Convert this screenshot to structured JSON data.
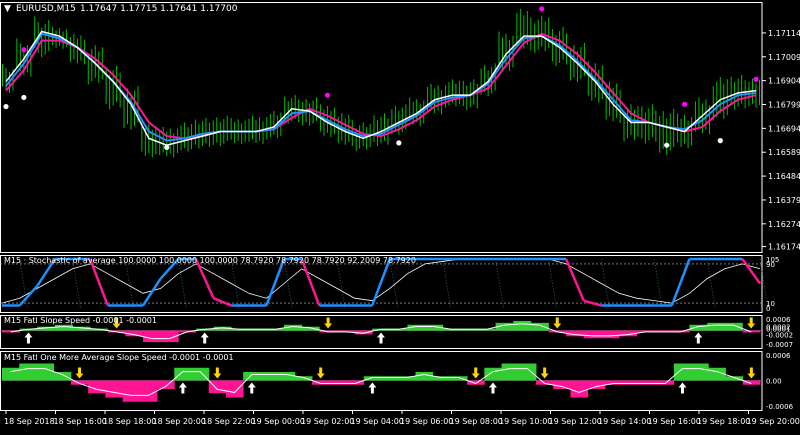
{
  "title": "EURUSD,M15",
  "ohlc": "1.17647 1.17715 1.17641 1.17700",
  "header_arrow": "▼",
  "colors": {
    "background": "#000000",
    "bull": "#00c000",
    "bear": "#ff1493",
    "fast_ma": "#ffffff",
    "slow_ma": "#1e90ff",
    "pink_ma": "#ff1493",
    "dot_pink": "#ff00ff",
    "dot_white": "#ffffff",
    "arrow_up": "#ffffff",
    "arrow_down": "#ffd700",
    "stoch_blue": "#1e90ff",
    "stoch_pink": "#ff1493",
    "hist_green": "#32cd32",
    "hist_pink": "#ff1493",
    "grid": "#c0c0c0",
    "axis": "#ffffff"
  },
  "x_axis": {
    "labels": [
      "18 Sep 2018",
      "18 Sep 16:00",
      "18 Sep 18:00",
      "18 Sep 20:00",
      "18 Sep 22:00",
      "19 Sep 00:00",
      "19 Sep 02:00",
      "19 Sep 04:00",
      "19 Sep 06:00",
      "19 Sep 08:00",
      "19 Sep 10:00",
      "19 Sep 12:00",
      "19 Sep 14:00",
      "19 Sep 16:00",
      "19 Sep 18:00",
      "19 Sep 20:00"
    ]
  },
  "chart_data": [
    {
      "type": "line",
      "panel": "price",
      "ylim": [
        1.1615,
        1.1725
      ],
      "yticks": [
        "1.17114",
        "1.17009",
        "1.16904",
        "1.16799",
        "1.16694",
        "1.16589",
        "1.16484",
        "1.16379",
        "1.16274",
        "1.16174"
      ],
      "series": [
        {
          "name": "fast",
          "values": [
            1.169,
            1.17,
            1.1712,
            1.171,
            1.1705,
            1.1698,
            1.169,
            1.168,
            1.1665,
            1.1662,
            1.1664,
            1.1666,
            1.1668,
            1.1668,
            1.1668,
            1.167,
            1.1678,
            1.1677,
            1.1672,
            1.1668,
            1.1665,
            1.1668,
            1.1672,
            1.1676,
            1.1682,
            1.1684,
            1.1684,
            1.169,
            1.1702,
            1.171,
            1.171,
            1.1705,
            1.1698,
            1.169,
            1.168,
            1.1672,
            1.1672,
            1.167,
            1.1668,
            1.1675,
            1.1682,
            1.1685,
            1.1686
          ]
        },
        {
          "name": "slow",
          "values": [
            1.1688,
            1.1698,
            1.1711,
            1.1709,
            1.1705,
            1.1698,
            1.169,
            1.1681,
            1.1668,
            1.1664,
            1.1665,
            1.1667,
            1.1668,
            1.1668,
            1.1668,
            1.1669,
            1.1676,
            1.1677,
            1.1673,
            1.1669,
            1.1666,
            1.1667,
            1.1671,
            1.1675,
            1.1681,
            1.1683,
            1.1684,
            1.1689,
            1.17,
            1.1709,
            1.171,
            1.1706,
            1.1699,
            1.1691,
            1.1682,
            1.1673,
            1.1672,
            1.167,
            1.1669,
            1.1673,
            1.168,
            1.1684,
            1.1685
          ]
        },
        {
          "name": "pink",
          "values": [
            1.1686,
            1.1695,
            1.1708,
            1.1708,
            1.1705,
            1.17,
            1.1693,
            1.1684,
            1.1672,
            1.1666,
            1.1665,
            1.1666,
            1.1668,
            1.1668,
            1.1668,
            1.1669,
            1.1674,
            1.1678,
            1.1675,
            1.1671,
            1.1667,
            1.1666,
            1.1669,
            1.1673,
            1.1679,
            1.1682,
            1.1684,
            1.1687,
            1.1697,
            1.1707,
            1.1711,
            1.1708,
            1.1702,
            1.1694,
            1.1685,
            1.1676,
            1.1672,
            1.167,
            1.1668,
            1.167,
            1.1677,
            1.1682,
            1.1684
          ]
        }
      ],
      "candles": [
        {
          "h": 1.1696,
          "l": 1.1684
        },
        {
          "h": 1.1706,
          "l": 1.1691
        },
        {
          "h": 1.1717,
          "l": 1.17
        },
        {
          "h": 1.1714,
          "l": 1.1704
        },
        {
          "h": 1.1711,
          "l": 1.1697
        },
        {
          "h": 1.1706,
          "l": 1.1688
        },
        {
          "h": 1.1697,
          "l": 1.1677
        },
        {
          "h": 1.1688,
          "l": 1.1668
        },
        {
          "h": 1.1672,
          "l": 1.1656
        },
        {
          "h": 1.167,
          "l": 1.1656
        },
        {
          "h": 1.1672,
          "l": 1.1658
        },
        {
          "h": 1.1674,
          "l": 1.166
        },
        {
          "h": 1.1675,
          "l": 1.1661
        },
        {
          "h": 1.1674,
          "l": 1.1662
        },
        {
          "h": 1.1675,
          "l": 1.1662
        },
        {
          "h": 1.1677,
          "l": 1.1664
        },
        {
          "h": 1.1684,
          "l": 1.1671
        },
        {
          "h": 1.1683,
          "l": 1.167
        },
        {
          "h": 1.168,
          "l": 1.1665
        },
        {
          "h": 1.1676,
          "l": 1.1661
        },
        {
          "h": 1.1672,
          "l": 1.1659
        },
        {
          "h": 1.1676,
          "l": 1.1661
        },
        {
          "h": 1.168,
          "l": 1.1666
        },
        {
          "h": 1.1683,
          "l": 1.167
        },
        {
          "h": 1.1689,
          "l": 1.1675
        },
        {
          "h": 1.1691,
          "l": 1.1678
        },
        {
          "h": 1.1691,
          "l": 1.1677
        },
        {
          "h": 1.1698,
          "l": 1.1683
        },
        {
          "h": 1.1712,
          "l": 1.1694
        },
        {
          "h": 1.1722,
          "l": 1.1703
        },
        {
          "h": 1.1719,
          "l": 1.1702
        },
        {
          "h": 1.1714,
          "l": 1.1696
        },
        {
          "h": 1.1707,
          "l": 1.1689
        },
        {
          "h": 1.1699,
          "l": 1.168
        },
        {
          "h": 1.169,
          "l": 1.1671
        },
        {
          "h": 1.168,
          "l": 1.1663
        },
        {
          "h": 1.168,
          "l": 1.1662
        },
        {
          "h": 1.1678,
          "l": 1.1657
        },
        {
          "h": 1.1676,
          "l": 1.166
        },
        {
          "h": 1.1683,
          "l": 1.1666
        },
        {
          "h": 1.1692,
          "l": 1.1672
        },
        {
          "h": 1.1693,
          "l": 1.1677
        },
        {
          "h": 1.1692,
          "l": 1.1678
        }
      ],
      "dots": [
        {
          "i": 1,
          "v": 1.1704,
          "c": "pink"
        },
        {
          "i": 0,
          "v": 1.1679,
          "c": "white"
        },
        {
          "i": 1,
          "v": 1.1683,
          "c": "white"
        },
        {
          "i": 9,
          "v": 1.1661,
          "c": "white"
        },
        {
          "i": 18,
          "v": 1.1684,
          "c": "pink"
        },
        {
          "i": 22,
          "v": 1.1663,
          "c": "white"
        },
        {
          "i": 30,
          "v": 1.1722,
          "c": "pink"
        },
        {
          "i": 38,
          "v": 1.168,
          "c": "pink"
        },
        {
          "i": 37,
          "v": 1.1662,
          "c": "white"
        },
        {
          "i": 40,
          "v": 1.1664,
          "c": "white"
        },
        {
          "i": 42,
          "v": 1.1691,
          "c": "pink"
        }
      ]
    },
    {
      "type": "line",
      "panel": "stochastic",
      "label": "M15 · Stochastic of average 100.0000 100.0000 100.0000 78.7920 78.7920 78.7920 92.2009 78.7920",
      "ylim": [
        0,
        100
      ],
      "yticks": [
        "105",
        "90",
        "10",
        "0"
      ],
      "series": [
        {
          "name": "k",
          "values": [
            5,
            5,
            45,
            100,
            100,
            100,
            5,
            5,
            5,
            60,
            100,
            100,
            20,
            5,
            5,
            5,
            100,
            100,
            5,
            5,
            5,
            5,
            100,
            100,
            100,
            100,
            100,
            100,
            100,
            100,
            100,
            100,
            100,
            15,
            5,
            5,
            5,
            5,
            5,
            100,
            100,
            100,
            100,
            50
          ]
        },
        {
          "name": "d",
          "values": [
            10,
            20,
            40,
            60,
            80,
            90,
            70,
            50,
            30,
            40,
            70,
            90,
            70,
            50,
            30,
            20,
            50,
            80,
            60,
            40,
            20,
            15,
            40,
            70,
            90,
            95,
            100,
            100,
            100,
            100,
            100,
            100,
            90,
            70,
            50,
            30,
            20,
            15,
            10,
            30,
            60,
            80,
            90,
            80
          ]
        }
      ]
    },
    {
      "type": "bar",
      "panel": "fatl_slope",
      "label": "M15 Fatl Slope Speed -0.0001 -0.0001",
      "ylim": [
        -0.0007,
        0.0006
      ],
      "yticks": [
        "0.0006",
        "0.0002",
        "0.0001",
        "-0.0002",
        "-0.0007"
      ],
      "values": [
        -0.0001,
        0.0001,
        0.0002,
        0.0003,
        0.0002,
        0.0001,
        -0.0001,
        -0.0003,
        -0.0006,
        -0.0006,
        -0.0001,
        0.0001,
        0.0002,
        0.0001,
        0.0001,
        0.0001,
        0.0003,
        0.0002,
        -0.0001,
        -0.0001,
        -0.0002,
        0.0001,
        0.0001,
        0.0003,
        0.0003,
        0.0001,
        0.0001,
        0.0001,
        0.0004,
        0.0005,
        0.0004,
        -0.0001,
        -0.0003,
        -0.0004,
        -0.0004,
        -0.0003,
        -0.0001,
        -0.0001,
        -0.0001,
        0.0003,
        0.0004,
        0.0004,
        -0.0001
      ]
    },
    {
      "type": "bar",
      "panel": "fatl_avg",
      "label": "M15 Fatl One More Average Slope Speed -0.0001 -0.0001",
      "ylim": [
        -0.0006,
        0.0006
      ],
      "yticks": [
        "0.0006",
        "0.00",
        "-0.0006"
      ],
      "values": [
        0.0003,
        0.0004,
        0.0004,
        0.0002,
        -0.0001,
        -0.0003,
        -0.0004,
        -0.0005,
        -0.0005,
        -0.0002,
        0.0003,
        0.0003,
        -0.0003,
        -0.0004,
        0.0002,
        0.0002,
        0.0002,
        0.0001,
        -0.0001,
        -0.0001,
        -0.0001,
        0.0001,
        0.0001,
        0.0001,
        0.0002,
        0.0001,
        0.0001,
        -0.0001,
        0.0003,
        0.0004,
        0.0004,
        -0.0001,
        -0.0002,
        -0.0004,
        -0.0002,
        -0.0001,
        -0.0001,
        -0.0001,
        -0.0001,
        0.0004,
        0.0004,
        0.0003,
        0.0001,
        -0.0001
      ]
    }
  ]
}
